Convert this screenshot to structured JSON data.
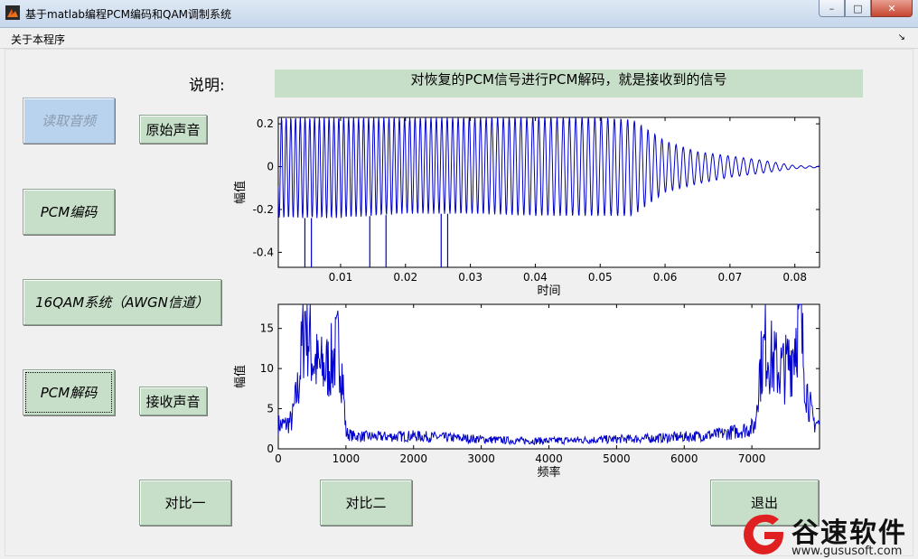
{
  "window": {
    "title": "基于matlab编程PCM编码和QAM调制系统",
    "controls": {
      "minimize": "–",
      "maximize": "□",
      "close": "✕"
    }
  },
  "menu": {
    "about": "关于本程序",
    "arrow": "↘"
  },
  "description": {
    "label": "说明:",
    "text": "对恢复的PCM信号进行PCM解码，就是接收到的信号"
  },
  "buttons": {
    "read_audio": "读取音频",
    "original_sound": "原始声音",
    "pcm_encode": "PCM编码",
    "qam_system": "16QAM系统（AWGN信道）",
    "pcm_decode": "PCM解码",
    "receive_sound": "接收声音",
    "compare1": "对比一",
    "compare2": "对比二",
    "exit": "退出"
  },
  "chart_data": [
    {
      "type": "line",
      "title": "",
      "xlabel": "时间",
      "ylabel": "幅值",
      "xlim": [
        0.0004,
        0.0838
      ],
      "ylim": [
        -0.47,
        0.23
      ],
      "xticks": [
        "0.01",
        "0.02",
        "0.03",
        "0.04",
        "0.05",
        "0.06",
        "0.07",
        "0.08"
      ],
      "yticks": [
        "0.2",
        "0",
        "-0.2",
        "-0.4"
      ],
      "line_color": "#0000cc",
      "envelope": {
        "t": [
          0.0004,
          0.01,
          0.02,
          0.03,
          0.04,
          0.05,
          0.055,
          0.06,
          0.065,
          0.07,
          0.075,
          0.08,
          0.0838
        ],
        "upper": [
          0.23,
          0.23,
          0.23,
          0.23,
          0.23,
          0.23,
          0.22,
          0.12,
          0.07,
          0.05,
          0.03,
          0.005,
          0.002
        ],
        "lower": [
          -0.24,
          -0.24,
          -0.22,
          -0.22,
          -0.23,
          -0.23,
          -0.23,
          -0.12,
          -0.08,
          -0.05,
          -0.03,
          -0.01,
          -0.004
        ]
      },
      "spikes": [
        {
          "t": 0.0045,
          "y": -0.47
        },
        {
          "t": 0.0055,
          "y": -0.47
        },
        {
          "t": 0.0145,
          "y": -0.47
        },
        {
          "t": 0.017,
          "y": -0.47
        },
        {
          "t": 0.0255,
          "y": -0.47
        },
        {
          "t": 0.0265,
          "y": -0.47
        }
      ]
    },
    {
      "type": "line",
      "title": "",
      "xlabel": "频率",
      "ylabel": "幅值",
      "xlim": [
        0,
        8000
      ],
      "ylim": [
        0,
        18
      ],
      "xticks": [
        "0",
        "1000",
        "2000",
        "3000",
        "4000",
        "5000",
        "6000",
        "7000"
      ],
      "yticks": [
        "15",
        "10",
        "5",
        "0"
      ],
      "line_color": "#0000cc",
      "x": [
        0,
        100,
        200,
        300,
        400,
        500,
        600,
        700,
        800,
        900,
        950,
        1000,
        1100,
        1500,
        2000,
        2500,
        3000,
        3500,
        4000,
        4500,
        5000,
        5500,
        6000,
        6500,
        6800,
        7000,
        7050,
        7100,
        7200,
        7300,
        7400,
        7500,
        7600,
        7700,
        7800,
        7900,
        8000
      ],
      "y": [
        3,
        3,
        3.5,
        8,
        17,
        11.5,
        10,
        10,
        11,
        13,
        9,
        2,
        1.6,
        1.5,
        1.6,
        1.4,
        1.2,
        1.0,
        1.0,
        1.1,
        1.2,
        1.3,
        1.5,
        1.8,
        2.2,
        2.6,
        3.0,
        9,
        13,
        11,
        10,
        10,
        12,
        17,
        8,
        3.5,
        3
      ]
    }
  ],
  "watermark": {
    "name": "谷速软件",
    "url": "www.gususoft.com"
  }
}
